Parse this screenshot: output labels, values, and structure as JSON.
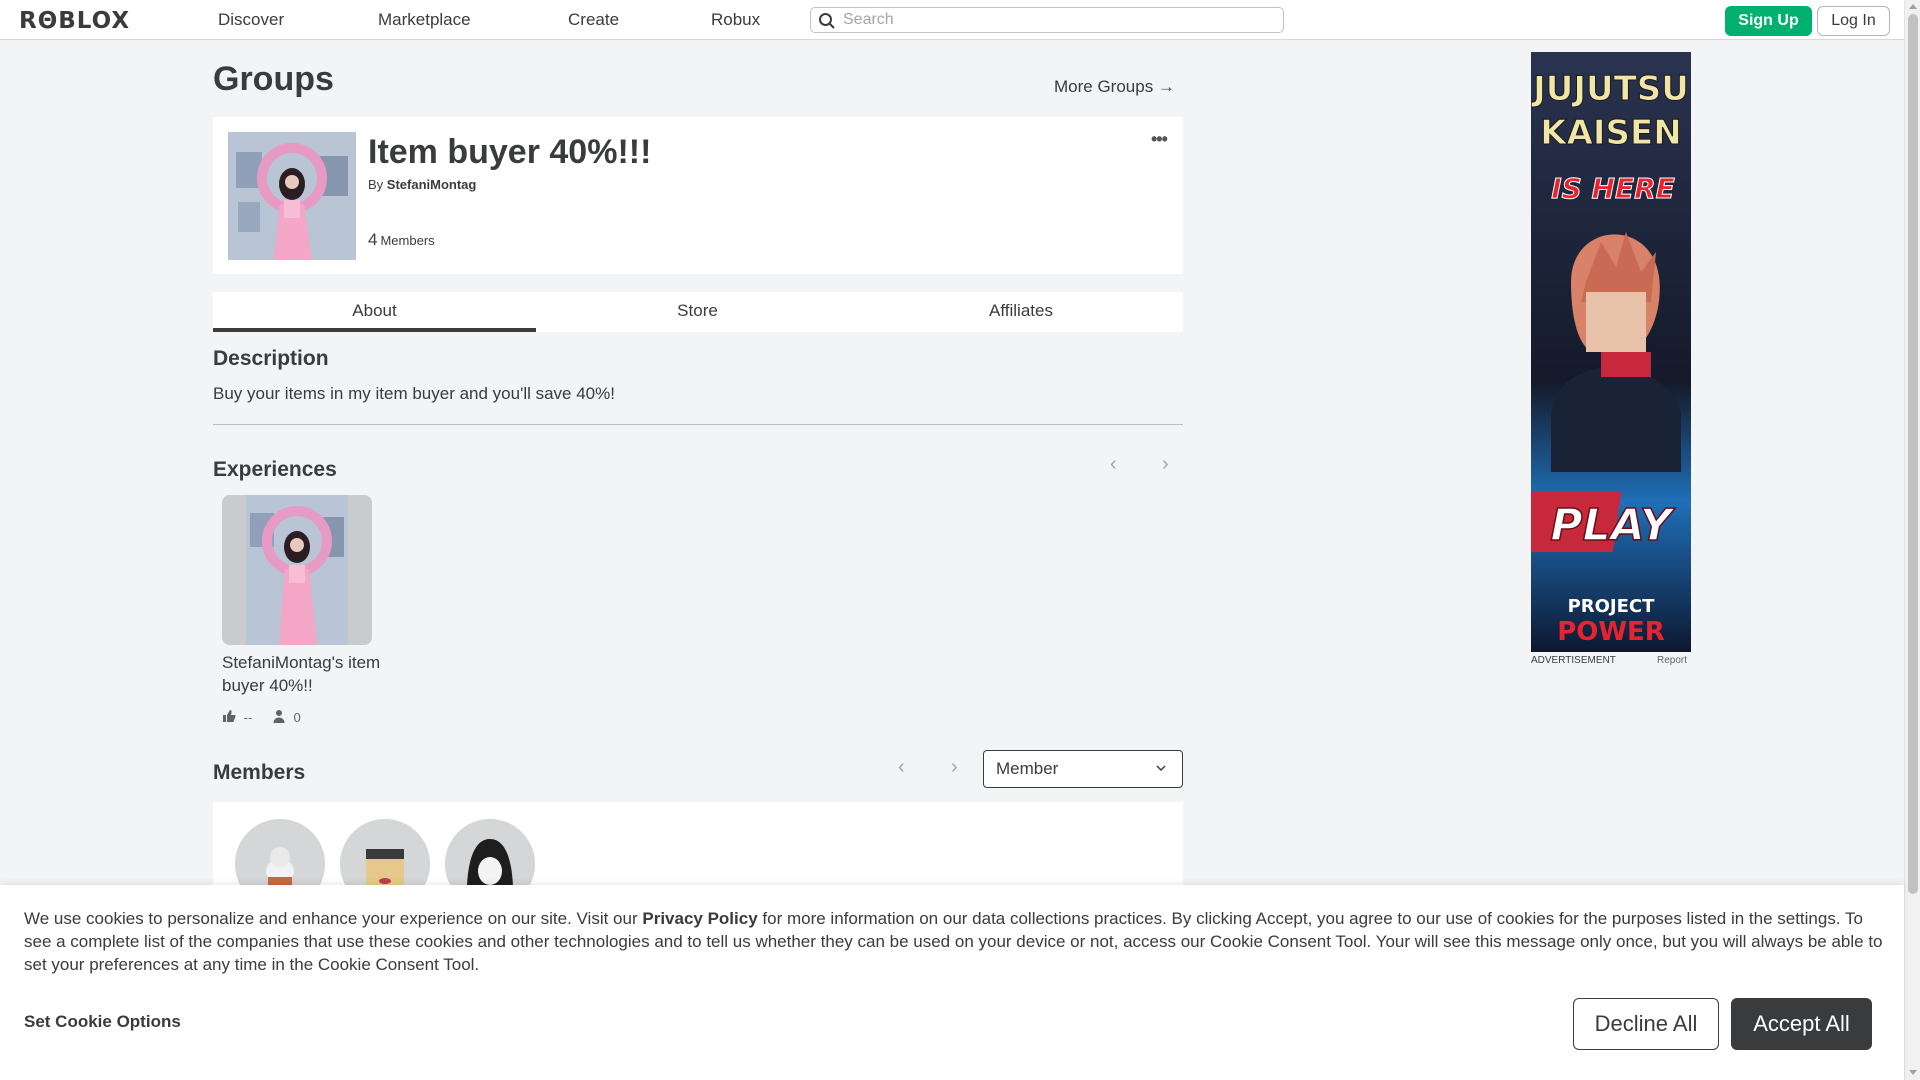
{
  "nav": {
    "logo": "RΘBLOX",
    "links": [
      "Discover",
      "Marketplace",
      "Create",
      "Robux"
    ],
    "search_placeholder": "Search",
    "signup_label": "Sign Up",
    "login_label": "Log In"
  },
  "page": {
    "title": "Groups",
    "more_groups": "More Groups →"
  },
  "group": {
    "name": "Item buyer 40%!!!",
    "by_prefix": "By",
    "owner": "StefaniMontag",
    "member_count": "4",
    "members_label": "Members",
    "more_icon": "ellipsis-icon"
  },
  "tabs": [
    "About",
    "Store",
    "Affiliates"
  ],
  "description": {
    "heading": "Description",
    "text": "Buy your items in my item buyer and you'll save 40%!"
  },
  "experiences": {
    "heading": "Experiences",
    "items": [
      {
        "name": "StefaniMontag's item buyer 40%!!",
        "likes": "--",
        "players": "0"
      }
    ]
  },
  "members": {
    "heading": "Members",
    "role_selected": "Member"
  },
  "ad": {
    "label": "ADVERTISEMENT",
    "report": "Report",
    "line1": "JUJUTSU",
    "line2": "KAISEN",
    "line3": "IS HERE",
    "play": "PLAY",
    "brand1": "PROJECT",
    "brand2": "POWER"
  },
  "cookie": {
    "text_before": "We use cookies to personalize and enhance your experience on our site. Visit our ",
    "policy": "Privacy Policy",
    "text_after": " for more information on our data collections practices. By clicking Accept, you agree to our use of cookies for the purposes listed in the settings. To see a complete list of the companies that use these cookies and other technologies and to tell us whether they can be used on your device or not, access our Cookie Consent Tool. Your will see this message only once, but you will always be able to set your preferences at any time in the Cookie Consent Tool.",
    "options": "Set Cookie Options",
    "decline": "Decline All",
    "accept": "Accept All"
  },
  "colors": {
    "signup_green": "#00b06f",
    "accent_dark": "#393b3d",
    "page_bg": "#f2f4f5"
  }
}
